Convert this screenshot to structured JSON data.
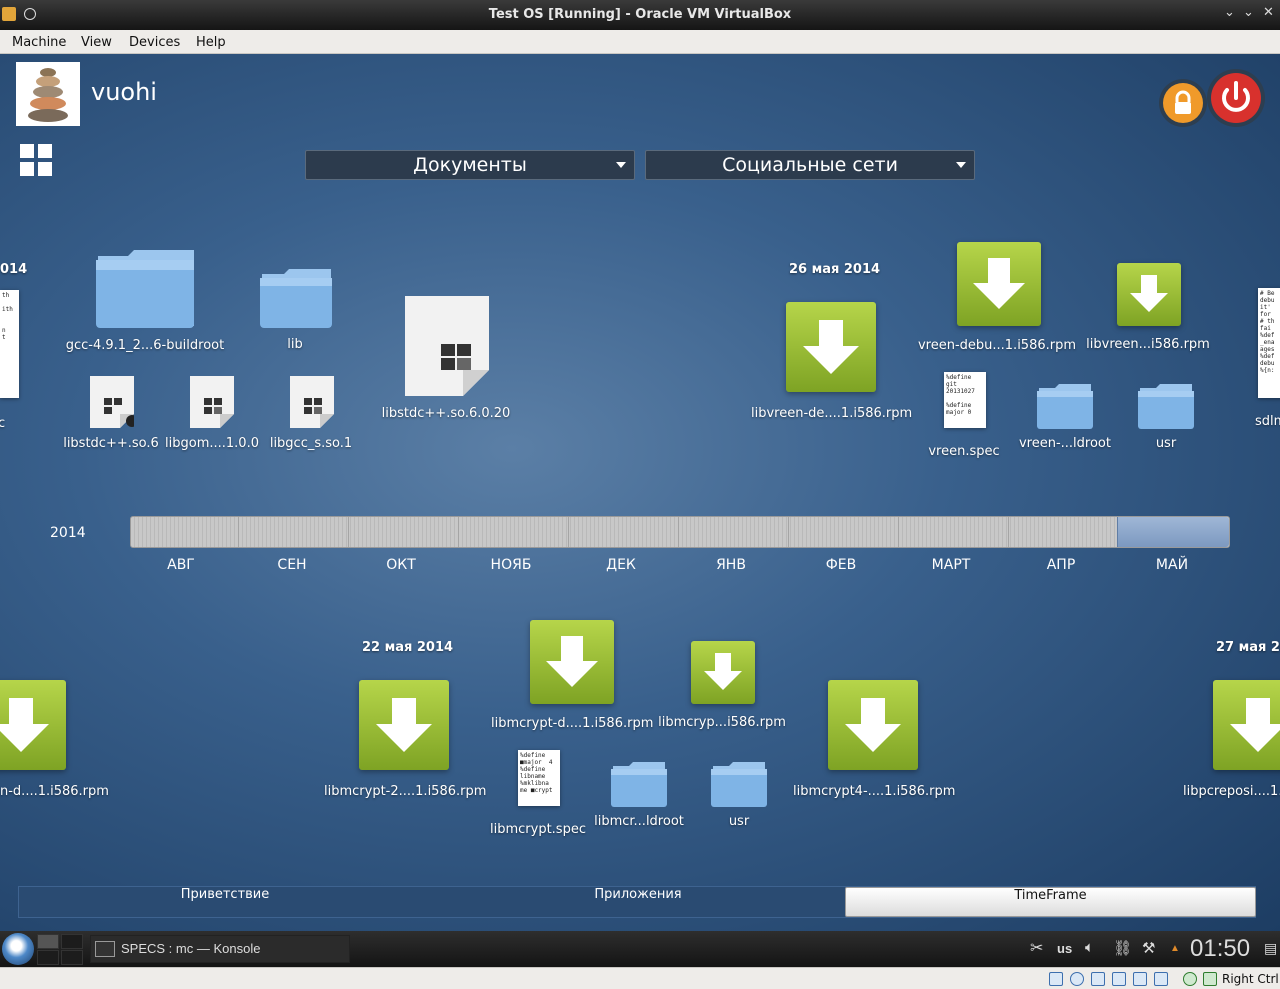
{
  "window": {
    "title": "Test OS [Running] - Oracle VM VirtualBox"
  },
  "menubar": {
    "items": [
      "Machine",
      "View",
      "Devices",
      "Help"
    ]
  },
  "user": {
    "name": "vuohi"
  },
  "activity_selector": {
    "left": "Документы",
    "right": "Социальные сети"
  },
  "groups_top": [
    {
      "date": "014"
    },
    {
      "date": "26 мая 2014"
    }
  ],
  "items_top": {
    "edge_left": "c",
    "gcc_folder": "gcc-4.9.1_2...6-buildroot",
    "lib_folder": "lib",
    "libstdcpp_big": "libstdc++.so.6.0.20",
    "libstdcpp": "libstdc++.so.6",
    "libgom": "libgom....1.0.0",
    "libgcc": "libgcc_s.so.1",
    "libvreen_de": "libvreen-de....1.i586.rpm",
    "vreen_debu": "vreen-debu...1.i586.rpm",
    "libvreen_i586": "libvreen...i586.rpm",
    "vreen_spec": "vreen.spec",
    "vreen_ldroot": "vreen-...ldroot",
    "usr": "usr",
    "edge_right": "sdlm"
  },
  "timeline": {
    "year": "2014",
    "months": [
      "АВГ",
      "СЕН",
      "ОКТ",
      "НОЯБ",
      "ДЕК",
      "ЯНВ",
      "ФЕВ",
      "МАРТ",
      "АПР",
      "МАЙ"
    ],
    "selected": "МАЙ"
  },
  "groups_bottom": [
    {
      "date": "22 мая 2014"
    },
    {
      "date": "27 мая 20"
    }
  ],
  "items_bottom": {
    "edge_left": "n-d....1.i586.rpm",
    "libmcrypt_2": "libmcrypt-2....1.i586.rpm",
    "libmcrypt_d": "libmcrypt-d....1.i586.rpm",
    "libmcryp_i586": "libmcryp...i586.rpm",
    "libmcrypt_spec": "libmcrypt.spec",
    "libmcr_ldroot": "libmcr...ldroot",
    "usr": "usr",
    "libmcrypt4": "libmcrypt4-....1.i586.rpm",
    "edge_right": "libpcreposi....1."
  },
  "doc_snippets": {
    "vreen_spec": "%define\ngit\n20131027\n\n%define\nmajor 0",
    "libmcrypt_spec": "%define\n■major  4\n%define\nlibname\n%mklibna\nme ■crypt",
    "edge_left": "th\n\nith\n\n\nn\nt",
    "edge_right": "# Be\ndebu\nit'\nfor\n# th\nfai\n%def\n_ena\nages\n%def\ndebu\n%{n:"
  },
  "tabs": [
    {
      "label": "Приветствие",
      "active": false
    },
    {
      "label": "Приложения",
      "active": false
    },
    {
      "label": "TimeFrame",
      "active": true
    }
  ],
  "taskbar": {
    "task": "SPECS : mc — Konsole",
    "layout": "us",
    "clock": "01:50"
  },
  "statusbar": {
    "host_key": "Right Ctrl"
  },
  "colors": {
    "rpm_green": "#8fb72e",
    "folder_blue": "#7fb4e6",
    "desktop_blue": "#39608c"
  }
}
